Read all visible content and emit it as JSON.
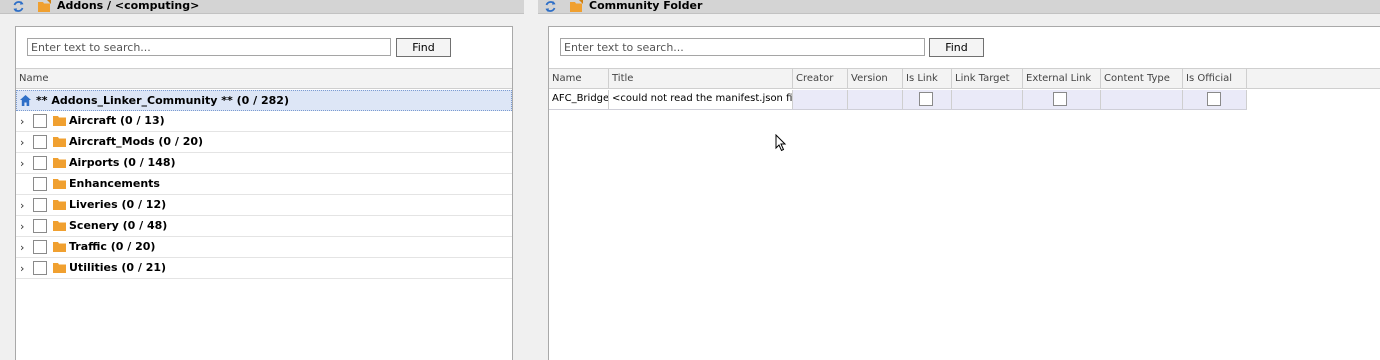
{
  "left": {
    "title": "Addons / <computing>",
    "search_placeholder": "Enter text to search...",
    "find_label": "Find",
    "column_name": "Name",
    "root_label": "** Addons_Linker_Community ** (0 / 282)",
    "items": [
      {
        "label": "Aircraft (0 / 13)",
        "expandable": true
      },
      {
        "label": "Aircraft_Mods (0 / 20)",
        "expandable": true
      },
      {
        "label": "Airports (0 / 148)",
        "expandable": true
      },
      {
        "label": "Enhancements",
        "expandable": false
      },
      {
        "label": "Liveries (0 / 12)",
        "expandable": true
      },
      {
        "label": "Scenery (0 / 48)",
        "expandable": true
      },
      {
        "label": "Traffic (0 / 20)",
        "expandable": true
      },
      {
        "label": "Utilities (0 / 21)",
        "expandable": true
      }
    ]
  },
  "right": {
    "title": "Community Folder",
    "search_placeholder": "Enter text to search...",
    "find_label": "Find",
    "columns": [
      "Name",
      "Title",
      "Creator",
      "Version",
      "Is Link",
      "Link Target",
      "External Link",
      "Content Type",
      "Is Official"
    ],
    "rows": [
      {
        "name": "AFC_Bridge",
        "title": "<could not read the manifest.json file>",
        "creator": "",
        "version": "",
        "is_link": false,
        "link_target": "",
        "external_link": false,
        "content_type": "",
        "is_official": false
      }
    ]
  },
  "colors": {
    "folder": "#f0a030",
    "refresh": "#2e6fc7",
    "root_selection": "#dde6f6",
    "row_highlight": "#eaeaf8"
  },
  "icons": [
    "refresh-icon",
    "folder-icon",
    "home-icon",
    "chevron-right-icon",
    "mouse-cursor-icon"
  ]
}
